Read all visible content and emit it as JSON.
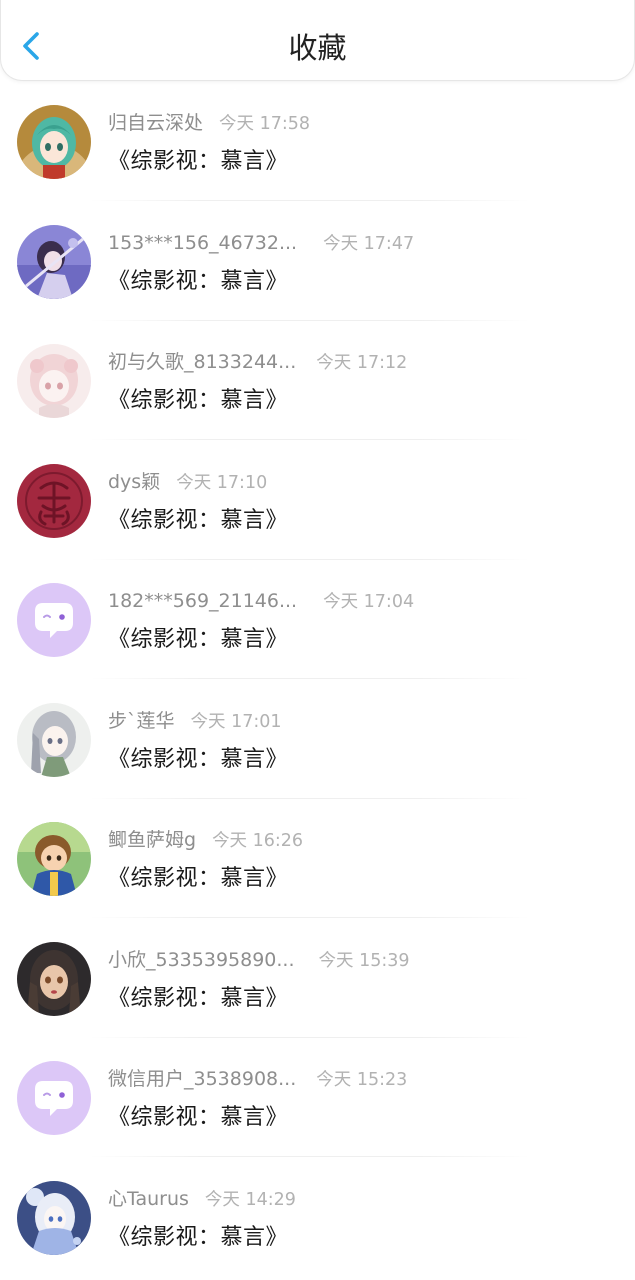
{
  "header": {
    "title": "收藏",
    "back_icon": "chevron-left-icon",
    "accent_color": "#2aa6e8"
  },
  "items": [
    {
      "user": "归自云深处",
      "time": "今天 17:58",
      "book": "《综影视：慕言》",
      "avatar": "anime-green-hair-avatar"
    },
    {
      "user": "153***156_46732...",
      "time": "今天 17:47",
      "book": "《综影视：慕言》",
      "avatar": "anime-purple-swordsman-avatar"
    },
    {
      "user": "初与久歌_8133244...",
      "time": "今天 17:12",
      "book": "《综影视：慕言》",
      "avatar": "anime-pink-sketch-avatar"
    },
    {
      "user": "dys颖",
      "time": "今天 17:10",
      "book": "《综影视：慕言》",
      "avatar": "red-seal-avatar"
    },
    {
      "user": "182***569_21146...",
      "time": "今天 17:04",
      "book": "《综影视：慕言》",
      "avatar": "default-chat-bubble-avatar"
    },
    {
      "user": "步`莲华",
      "time": "今天 17:01",
      "book": "《综影视：慕言》",
      "avatar": "anime-silver-hair-avatar"
    },
    {
      "user": "鲫鱼萨姆g",
      "time": "今天 16:26",
      "book": "《综影视：慕言》",
      "avatar": "anime-boy-blue-jacket-avatar"
    },
    {
      "user": "小欣_5335395890...",
      "time": "今天 15:39",
      "book": "《综影视：慕言》",
      "avatar": "anime-dark-hair-girl-avatar"
    },
    {
      "user": "微信用户_3538908...",
      "time": "今天 15:23",
      "book": "《综影视：慕言》",
      "avatar": "default-chat-bubble-avatar"
    },
    {
      "user": "心Taurus",
      "time": "今天 14:29",
      "book": "《综影视：慕言》",
      "avatar": "anime-white-hair-blue-avatar"
    }
  ]
}
